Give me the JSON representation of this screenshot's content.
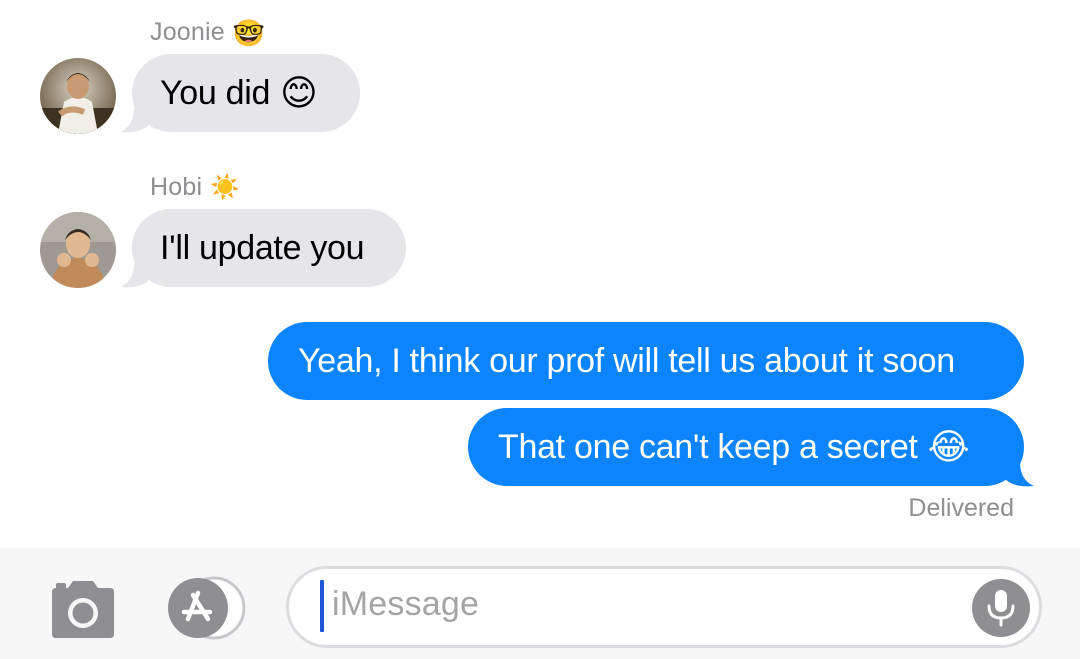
{
  "thread": {
    "messages": [
      {
        "sender": "Joonie",
        "sender_emoji": "🤓",
        "text": "You did",
        "emoji": "😊",
        "direction": "incoming"
      },
      {
        "sender": "Hobi",
        "sender_emoji": "☀️",
        "text": "I'll update you",
        "direction": "incoming"
      },
      {
        "text": "Yeah, I think our prof will tell us about it soon",
        "direction": "outgoing"
      },
      {
        "text": "That one can't keep a secret",
        "emoji": "😂",
        "direction": "outgoing"
      }
    ],
    "status": "Delivered"
  },
  "input": {
    "placeholder": "iMessage"
  },
  "icons": {
    "camera": "camera-icon",
    "app_store": "app-store-icon",
    "microphone": "microphone-icon"
  },
  "colors": {
    "outgoing_bubble": "#0b84fe",
    "incoming_bubble": "#e5e5ea",
    "secondary_text": "#8e8e93"
  }
}
